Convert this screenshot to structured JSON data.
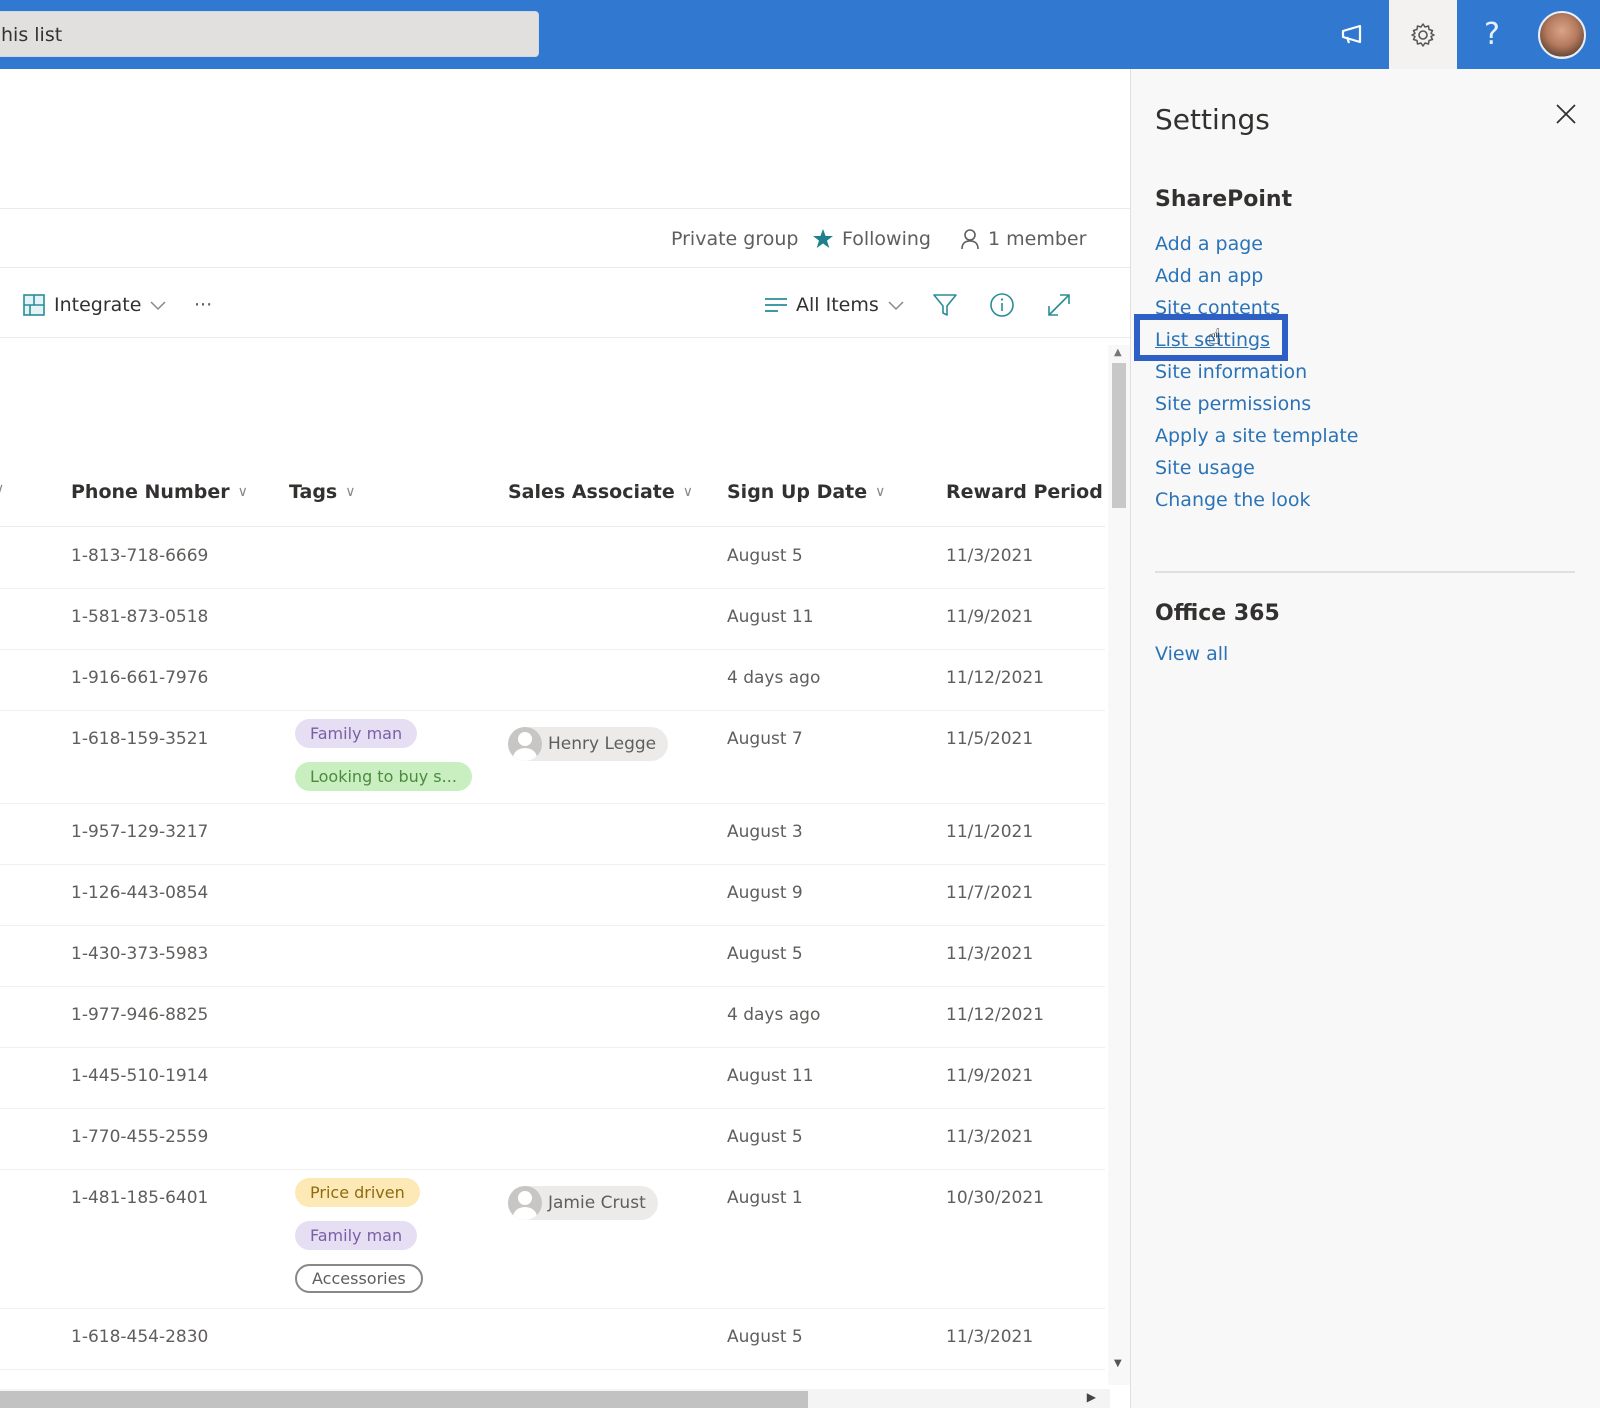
{
  "suitebar": {
    "search_value": "his list",
    "icons": [
      "megaphone-icon",
      "gear-icon",
      "help-icon",
      "avatar"
    ],
    "help_glyph": "?",
    "color": "#3178d0"
  },
  "group_info": {
    "privacy": "Private group",
    "following": "Following",
    "members": "1 member"
  },
  "command_bar": {
    "integrate": "Integrate",
    "more": "···",
    "view": "All Items"
  },
  "grid": {
    "columns": [
      {
        "label": "Phone Number"
      },
      {
        "label": "Tags"
      },
      {
        "label": "Sales Associate"
      },
      {
        "label": "Sign Up Date"
      },
      {
        "label": "Reward Period ..."
      }
    ],
    "rows": [
      {
        "phone": "1-813-718-6669",
        "tags": [],
        "associate": "",
        "signup": "August 5",
        "reward": "11/3/2021"
      },
      {
        "phone": "1-581-873-0518",
        "tags": [],
        "associate": "",
        "signup": "August 11",
        "reward": "11/9/2021"
      },
      {
        "phone": "1-916-661-7976",
        "tags": [],
        "associate": "",
        "signup": "4 days ago",
        "reward": "11/12/2021"
      },
      {
        "phone": "1-618-159-3521",
        "tags": [
          {
            "label": "Family man",
            "style": "purple"
          },
          {
            "label": "Looking to buy s...",
            "style": "green"
          }
        ],
        "associate": "Henry Legge",
        "signup": "August 7",
        "reward": "11/5/2021"
      },
      {
        "phone": "1-957-129-3217",
        "tags": [],
        "associate": "",
        "signup": "August 3",
        "reward": "11/1/2021"
      },
      {
        "phone": "1-126-443-0854",
        "tags": [],
        "associate": "",
        "signup": "August 9",
        "reward": "11/7/2021"
      },
      {
        "phone": "1-430-373-5983",
        "tags": [],
        "associate": "",
        "signup": "August 5",
        "reward": "11/3/2021"
      },
      {
        "phone": "1-977-946-8825",
        "tags": [],
        "associate": "",
        "signup": "4 days ago",
        "reward": "11/12/2021"
      },
      {
        "phone": "1-445-510-1914",
        "tags": [],
        "associate": "",
        "signup": "August 11",
        "reward": "11/9/2021"
      },
      {
        "phone": "1-770-455-2559",
        "tags": [],
        "associate": "",
        "signup": "August 5",
        "reward": "11/3/2021"
      },
      {
        "phone": "1-481-185-6401",
        "tags": [
          {
            "label": "Price driven",
            "style": "yellow"
          },
          {
            "label": "Family man",
            "style": "purple"
          },
          {
            "label": "Accessories",
            "style": "outline"
          }
        ],
        "associate": "Jamie Crust",
        "signup": "August 1",
        "reward": "10/30/2021"
      },
      {
        "phone": "1-618-454-2830",
        "tags": [],
        "associate": "",
        "signup": "August 5",
        "reward": "11/3/2021"
      }
    ]
  },
  "settings_panel": {
    "title": "Settings",
    "sharepoint_heading": "SharePoint",
    "sharepoint_links": [
      "Add a page",
      "Add an app",
      "Site contents",
      "List settings",
      "Site information",
      "Site permissions",
      "Apply a site template",
      "Site usage",
      "Change the look"
    ],
    "highlighted_link": "List settings",
    "office_heading": "Office 365",
    "office_link": "View all",
    "link_color": "#2b73b6",
    "highlight_color": "#2e5fc4"
  }
}
